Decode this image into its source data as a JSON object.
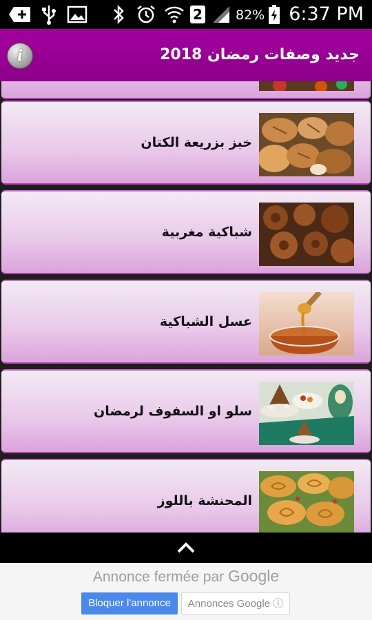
{
  "status_bar": {
    "battery_percent": "82%",
    "time": "6:37 PM",
    "notification_count": "2",
    "icons": [
      "add-icon",
      "usb-icon",
      "image-icon",
      "bluetooth-icon",
      "alarm-icon",
      "wifi-icon",
      "notification-count-icon",
      "cell-signal-icon",
      "battery-charging-icon"
    ]
  },
  "app_bar": {
    "title": "جديد وصفات رمضان 2018",
    "info_icon": "info-icon",
    "color": "#9b0097"
  },
  "recipes": [
    {
      "label": "خبز بزريعة الكتان",
      "image": "bread-thumbnail"
    },
    {
      "label": "شباكية مغربية",
      "image": "chebakia-thumbnail"
    },
    {
      "label": "عسل الشباكية",
      "image": "honey-thumbnail"
    },
    {
      "label": "سلو او السفوف لرمضان",
      "image": "sellou-thumbnail"
    },
    {
      "label": "المحنشة باللوز",
      "image": "mhancha-thumbnail"
    }
  ],
  "bottom_bar": {
    "icon": "chevron-up-icon"
  },
  "ad": {
    "closed_text": "Annonce fermée par",
    "brand": "Google",
    "block_button": "Bloquer l'annonce",
    "ads_button": "Annonces Google ⓘ",
    "accent": "#4a89ea"
  }
}
